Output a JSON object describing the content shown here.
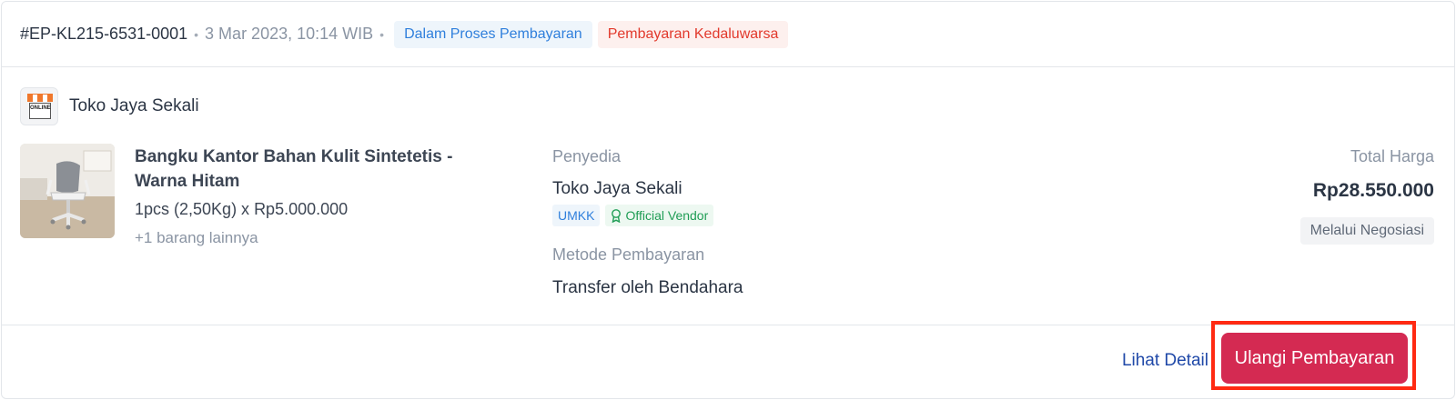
{
  "order": {
    "id": "#EP-KL215-6531-0001",
    "date": "3 Mar 2023, 10:14 WIB",
    "separator": "•",
    "status_badges": [
      {
        "label": "Dalam Proses Pembayaran",
        "color": "#2f7fdc"
      },
      {
        "label": "Pembayaran Kedaluwarsa",
        "color": "#e2392c"
      }
    ]
  },
  "store": {
    "name": "Toko Jaya Sekali",
    "logo_text": "ONLINE",
    "logo_icon": "online-shop-icon"
  },
  "product": {
    "name": "Bangku Kantor Bahan Kulit Sintetetis - Warna Hitam",
    "quantity_price": "1pcs (2,50Kg) x Rp5.000.000",
    "more_items": "+1 barang lainnya",
    "image_icon": "office-chair-image"
  },
  "provider": {
    "label": "Penyedia",
    "name": "Toko Jaya Sekali",
    "tags": [
      {
        "label": "UMKK"
      },
      {
        "label": "Official Vendor",
        "icon": "award-icon"
      }
    ]
  },
  "payment": {
    "label": "Metode Pembayaran",
    "method": "Transfer oleh Bendahara"
  },
  "total": {
    "label": "Total Harga",
    "value": "Rp28.550.000",
    "negotiation_badge": "Melalui Negosiasi"
  },
  "actions": {
    "detail_label": "Lihat Detail",
    "retry_payment_label": "Ulangi Pembayaran",
    "retry_button_color": "#d42a52",
    "highlight_color": "#ff2a12"
  }
}
